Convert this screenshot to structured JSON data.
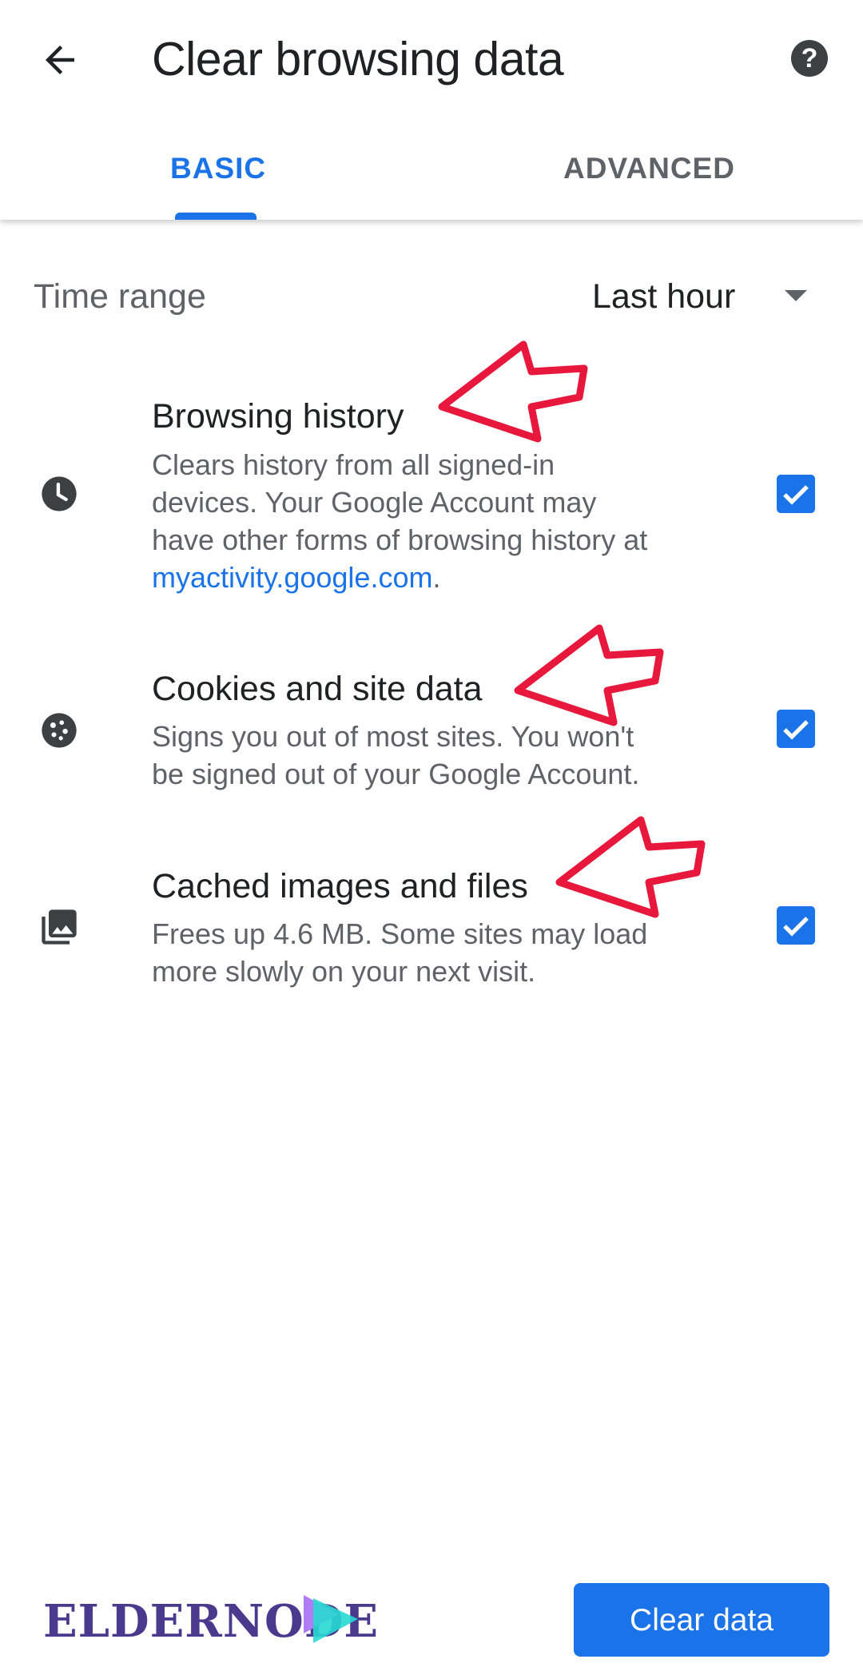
{
  "header": {
    "title": "Clear browsing data",
    "back_icon": "arrow-back-icon",
    "help_icon": "help-icon",
    "help_glyph": "?"
  },
  "tabs": [
    {
      "label": "BASIC",
      "selected": true
    },
    {
      "label": "ADVANCED",
      "selected": false
    }
  ],
  "time_range": {
    "label": "Time range",
    "value": "Last hour"
  },
  "options": [
    {
      "icon": "clock-icon",
      "title": "Browsing history",
      "desc_lines": [
        "Clears history from all signed-in",
        "devices. Your Google Account may",
        "have other forms of browsing history at"
      ],
      "link": "myactivity.google.com",
      "link_suffix": ".",
      "checked": true
    },
    {
      "icon": "cookie-icon",
      "title": "Cookies and site data",
      "desc_lines": [
        "Signs you out of most sites. You won't",
        "be signed out of your Google Account."
      ],
      "checked": true
    },
    {
      "icon": "photo-library-icon",
      "title": "Cached images and files",
      "desc_lines": [
        "Frees up 4.6 MB. Some sites may load",
        "more slowly on your next visit."
      ],
      "checked": true
    }
  ],
  "footer": {
    "logo_text": "ELDERNODE",
    "clear_button": "Clear data"
  },
  "colors": {
    "accent": "#1a73e8",
    "annotation_arrow": "#e8173c",
    "logo": "#4a3a8e"
  }
}
